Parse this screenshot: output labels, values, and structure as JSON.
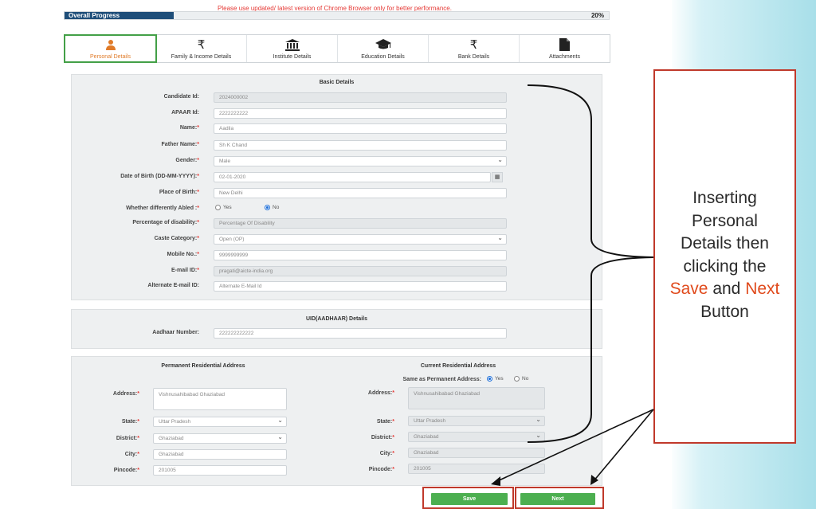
{
  "notice": "Please use updated/ latest version of Chrome Browser only for better performance.",
  "progress": {
    "label": "Overall Progress",
    "percent_text": "20%",
    "percent": 0.2
  },
  "tabs": [
    {
      "label": "Personal Details",
      "icon": "person-icon"
    },
    {
      "label": "Family & Income Details",
      "icon": "rupee-icon"
    },
    {
      "label": "Institute Details",
      "icon": "institute-icon"
    },
    {
      "label": "Education Details",
      "icon": "graduation-cap-icon"
    },
    {
      "label": "Bank Details",
      "icon": "rupee-icon"
    },
    {
      "label": "Attachments",
      "icon": "document-icon"
    }
  ],
  "basic": {
    "title": "Basic Details",
    "candidate_id": {
      "label": "Candidate Id:",
      "value": "2024000002"
    },
    "apaar_id": {
      "label": "APAAR Id:",
      "value": "2222222222"
    },
    "name": {
      "label": "Name:",
      "value": "Aadila"
    },
    "father_name": {
      "label": "Father Name:",
      "value": "Sh K Chand"
    },
    "gender": {
      "label": "Gender:",
      "value": "Male"
    },
    "dob": {
      "label": "Date of Birth (DD-MM-YYYY):",
      "value": "02-01-2020"
    },
    "place_of_birth": {
      "label": "Place of Birth:",
      "value": "New Delhi"
    },
    "differently_abled": {
      "label": "Whether differently Abled :",
      "yes": "Yes",
      "no": "No"
    },
    "disability_pct": {
      "label": "Percentage of disability:",
      "placeholder": "Percentage Of Disability"
    },
    "caste": {
      "label": "Caste Category:",
      "value": "Open (OP)"
    },
    "mobile": {
      "label": "Mobile No.:",
      "value": "9999999999"
    },
    "email": {
      "label": "E-mail ID:",
      "value": "pragati@aicte-india.org"
    },
    "alt_email": {
      "label": "Alternate E-mail ID:",
      "placeholder": "Alternate E-Mail Id"
    }
  },
  "uid": {
    "title": "UID(AADHAAR) Details",
    "aadhaar": {
      "label": "Aadhaar Number:",
      "value": "222222222222"
    }
  },
  "address": {
    "permanent_title": "Permanent Residential Address",
    "current_title": "Current Residential Address",
    "same_as": {
      "label": "Same as Permanent Address:",
      "yes": "Yes",
      "no": "No"
    },
    "perm": {
      "address": {
        "label": "Address:",
        "value": "Vishnusahibabad Ghaziabad"
      },
      "state": {
        "label": "State:",
        "value": "Uttar Pradesh"
      },
      "district": {
        "label": "District:",
        "value": "Ghaziabad"
      },
      "city": {
        "label": "City:",
        "value": "Ghaziabad"
      },
      "pincode": {
        "label": "Pincode:",
        "value": "201005"
      }
    },
    "curr": {
      "address": {
        "label": "Address:",
        "value": "Vishnusahibabad Ghaziabad"
      },
      "state": {
        "label": "State:",
        "value": "Uttar Pradesh"
      },
      "district": {
        "label": "District:",
        "value": "Ghaziabad"
      },
      "city": {
        "label": "City:",
        "value": "Ghaziabad"
      },
      "pincode": {
        "label": "Pincode:",
        "value": "201005"
      }
    }
  },
  "buttons": {
    "save": "Save",
    "next": "Next"
  },
  "callout": {
    "line1": "Inserting",
    "line2": "Personal",
    "line3": "Details then",
    "line4": "clicking the",
    "save_word": "Save",
    "and_word": " and ",
    "next_word": "Next",
    "line6": "Button"
  },
  "colors": {
    "accent_green": "#4caf50",
    "progress_blue": "#1f4e79",
    "callout_red": "#c0392b",
    "highlight": "#e04a1c"
  }
}
